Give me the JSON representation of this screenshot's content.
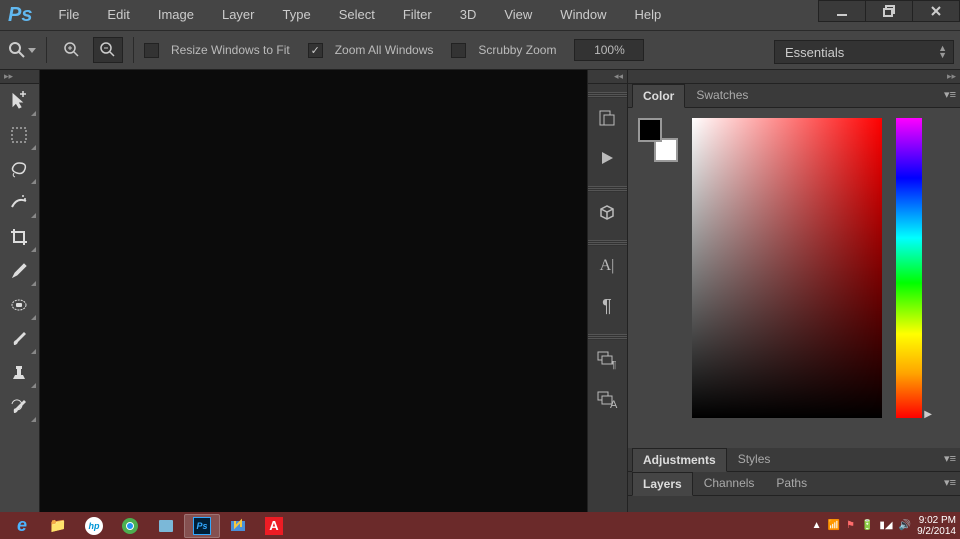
{
  "app": {
    "logo": "Ps"
  },
  "menus": [
    "File",
    "Edit",
    "Image",
    "Layer",
    "Type",
    "Select",
    "Filter",
    "3D",
    "View",
    "Window",
    "Help"
  ],
  "options": {
    "resize_label": "Resize Windows to Fit",
    "zoom_all_label": "Zoom All Windows",
    "scrubby_label": "Scrubby Zoom",
    "zoom_value": "100%",
    "zoom_all_checked": true
  },
  "workspace": {
    "selected": "Essentials"
  },
  "panels": {
    "color_tab": "Color",
    "swatches_tab": "Swatches",
    "adjustments_tab": "Adjustments",
    "styles_tab": "Styles",
    "layers_tab": "Layers",
    "channels_tab": "Channels",
    "paths_tab": "Paths"
  },
  "tools": {
    "move": "move-tool",
    "marquee": "marquee-tool",
    "lasso": "lasso-tool",
    "quickselect": "quick-selection-tool",
    "crop": "crop-tool",
    "eyedropper": "eyedropper-tool",
    "healing": "healing-brush-tool",
    "brush": "brush-tool",
    "stamp": "clone-stamp-tool",
    "history": "history-brush-tool"
  },
  "taskbar": {
    "time": "9:02 PM",
    "date": "9/2/2014",
    "apps": [
      "ie",
      "explorer",
      "hp",
      "chrome",
      "reader",
      "photoshop",
      "idm",
      "adobe"
    ]
  }
}
